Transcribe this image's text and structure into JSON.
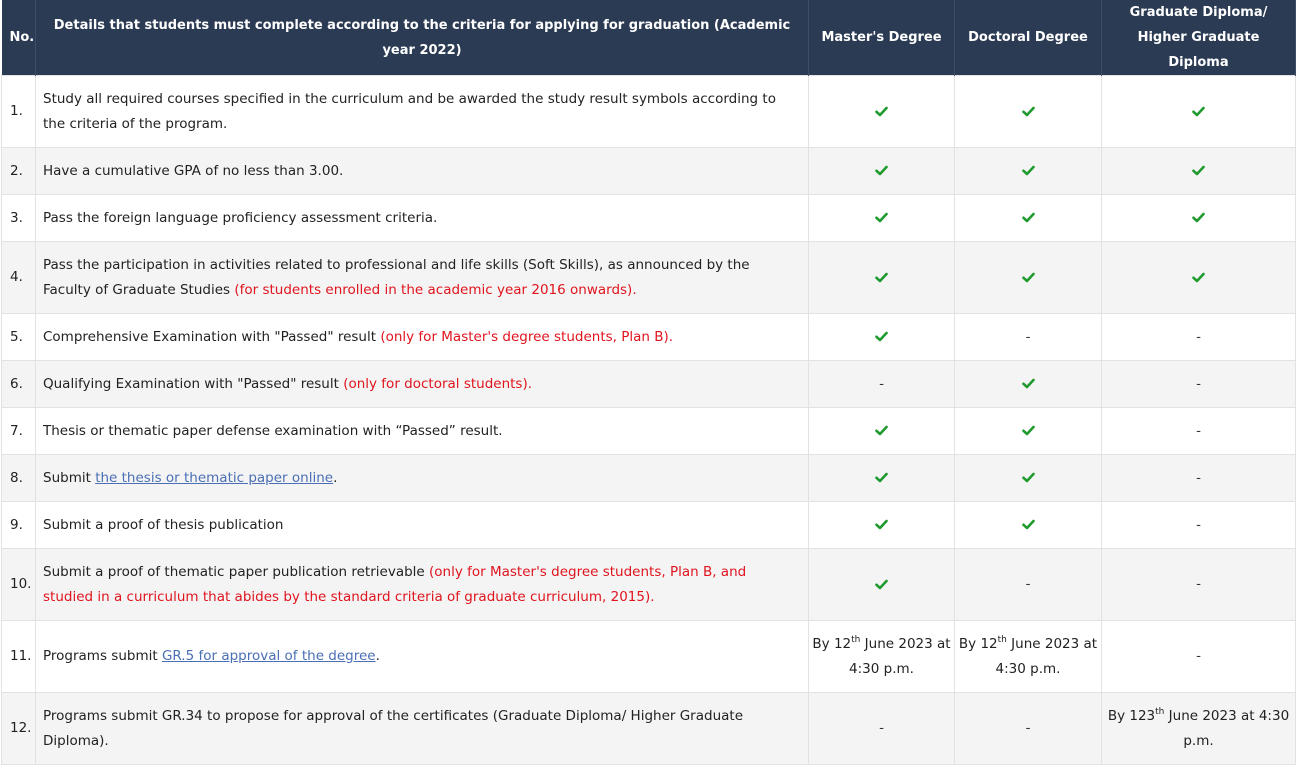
{
  "header": {
    "no": "No.",
    "details": "Details that students must complete according to the criteria for applying for graduation (Academic year 2022)",
    "masters": "Master's Degree",
    "doctoral": "Doctoral Degree",
    "diploma": "Graduate Diploma/ Higher Graduate Diploma"
  },
  "dash": "-",
  "rows": [
    {
      "no": "1.",
      "text": "Study all required courses specified in the curriculum and be awarded the study result symbols according to the criteria of the program."
    },
    {
      "no": "2.",
      "text": "Have a cumulative GPA of no less than 3.00."
    },
    {
      "no": "3.",
      "text": "Pass the foreign language proficiency assessment criteria."
    },
    {
      "no": "4.",
      "text": "Pass the participation in activities related to professional and life skills (Soft Skills), as announced by the Faculty of Graduate Studies ",
      "note": "(for students enrolled in the academic year 2016 onwards)."
    },
    {
      "no": "5.",
      "text": "Comprehensive Examination with \"Passed\" result ",
      "note": "(only for Master's degree students, Plan B)."
    },
    {
      "no": "6.",
      "text": "Qualifying Examination with \"Passed\" result ",
      "note": "(only for doctoral students)."
    },
    {
      "no": "7.",
      "text": "Thesis or thematic paper defense examination with “Passed” result."
    },
    {
      "no": "8.",
      "text": "Submit ",
      "link": "the thesis or thematic paper online",
      "after": "."
    },
    {
      "no": "9.",
      "text": "Submit a proof of thesis publication"
    },
    {
      "no": "10.",
      "text": "Submit a proof of thematic paper publication retrievable ",
      "note": "(only for Master's degree students, Plan B, and studied in a curriculum that abides by the standard criteria of graduate curriculum, 2015)."
    },
    {
      "no": "11.",
      "text": "Programs submit ",
      "link": "GR.5 for approval of the degree",
      "after": ".",
      "masters": {
        "a": "By 12",
        "sup": "th",
        "b": " June 2023 at 4:30 p.m."
      },
      "doctoral": {
        "a": "By 12",
        "sup": "th",
        "b": " June 2023 at 4:30 p.m."
      }
    },
    {
      "no": "12.",
      "text": "Programs submit GR.34 to propose for approval of the certificates (Graduate Diploma/ Higher Graduate Diploma).",
      "diploma": {
        "a": "By 123",
        "sup": "th",
        "b": " June 2023 at 4:30 p.m."
      }
    }
  ],
  "colors": {
    "check": "#1f9a2e",
    "note": "#e0141e",
    "link": "#4a6fb5",
    "header_bg": "#2c3b54"
  },
  "icons": {
    "check": "check-icon",
    "dash": "dash"
  }
}
